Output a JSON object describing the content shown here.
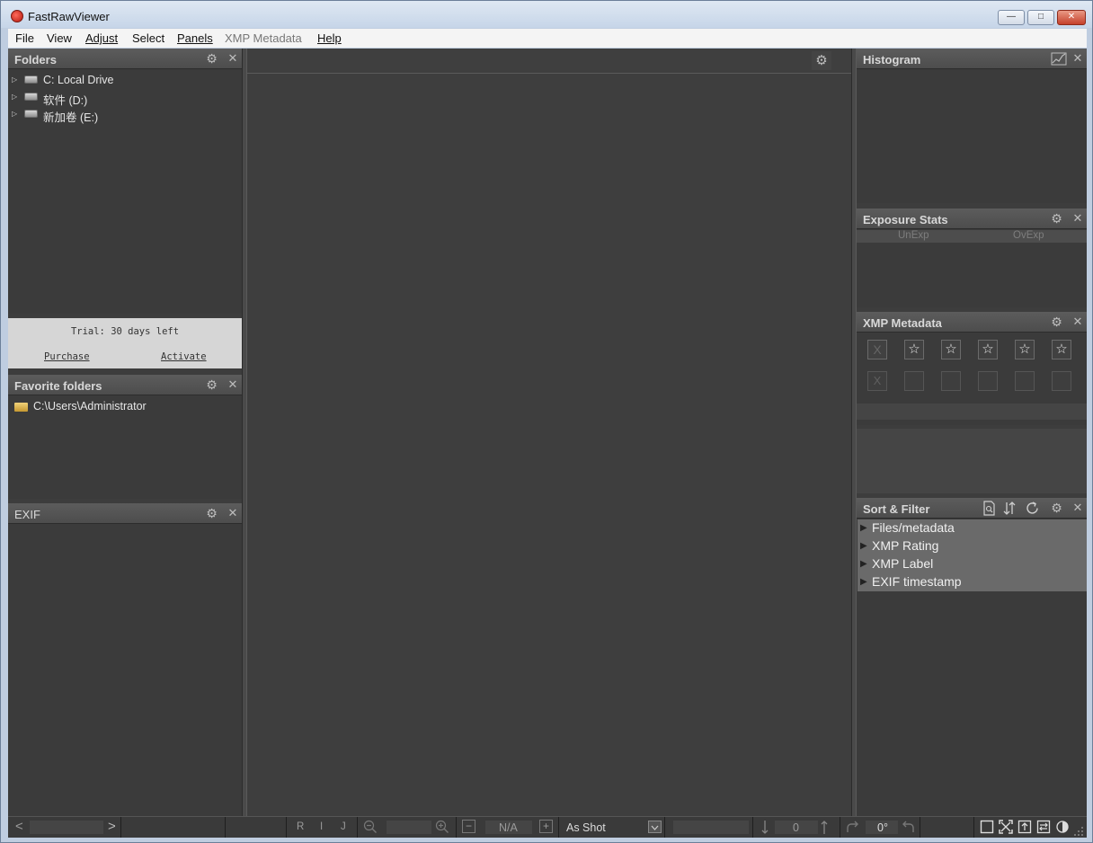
{
  "window": {
    "title": "FastRawViewer",
    "minimize_label": "—",
    "restore_label": "□",
    "close_label": "✕"
  },
  "menu": {
    "file": "File",
    "view": "View",
    "adjust": "Adjust",
    "select": "Select",
    "panels": "Panels",
    "xmp_metadata": "XMP Metadata",
    "help": "Help"
  },
  "folders": {
    "title": "Folders",
    "items": [
      {
        "label": "C: Local Drive"
      },
      {
        "label": "软件 (D:)"
      },
      {
        "label": "新加卷 (E:)"
      }
    ]
  },
  "trial": {
    "text": "Trial: 30 days left",
    "purchase": "Purchase",
    "activate": "Activate"
  },
  "favorites": {
    "title": "Favorite folders",
    "items": [
      {
        "label": "C:\\Users\\Administrator"
      }
    ]
  },
  "exif": {
    "title": "EXIF"
  },
  "histogram": {
    "title": "Histogram"
  },
  "exposure_stats": {
    "title": "Exposure Stats",
    "unexp": "UnExp",
    "ovexp": "OvExp"
  },
  "xmp": {
    "title": "XMP Metadata",
    "reject_mark": "X",
    "star": "☆"
  },
  "sort_filter": {
    "title": "Sort & Filter",
    "items": [
      {
        "label": "Files/metadata"
      },
      {
        "label": "XMP Rating"
      },
      {
        "label": "XMP Label"
      },
      {
        "label": "EXIF timestamp"
      }
    ]
  },
  "statusbar": {
    "prev": "<",
    "next": ">",
    "r": "R",
    "i": "I",
    "j": "J",
    "minus": "−",
    "zoom_value": "N/A",
    "plus": "+",
    "white_balance": "As Shot",
    "count": "0",
    "rotation": "0°"
  },
  "icons": {
    "gear": "⚙",
    "close": "✕",
    "expand": "▷",
    "triangle": "▶"
  }
}
